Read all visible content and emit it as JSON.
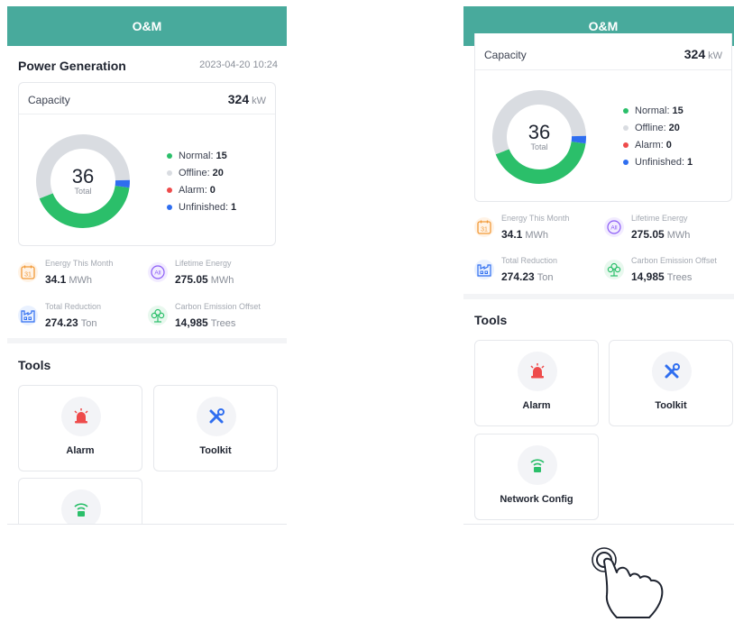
{
  "left": {
    "appbar_title": "O&M",
    "section_title": "Power Generation",
    "timestamp": "2023-04-20 10:24",
    "capacity_label": "Capacity",
    "capacity_value": "324",
    "capacity_unit": "kW",
    "donut_total": "36",
    "donut_total_label": "Total",
    "legend": [
      {
        "label": "Normal:",
        "value": "15"
      },
      {
        "label": "Offline:",
        "value": "20"
      },
      {
        "label": "Alarm:",
        "value": "0"
      },
      {
        "label": "Unfinished:",
        "value": "1"
      }
    ],
    "stats": [
      {
        "label": "Energy This Month",
        "value": "34.1",
        "unit": "MWh"
      },
      {
        "label": "Lifetime Energy",
        "value": "275.05",
        "unit": "MWh"
      },
      {
        "label": "Total Reduction",
        "value": "274.23",
        "unit": "Ton"
      },
      {
        "label": "Carbon Emission Offset",
        "value": "14,985",
        "unit": "Trees"
      }
    ],
    "tools_title": "Tools",
    "tools": [
      {
        "label": "Alarm"
      },
      {
        "label": "Toolkit"
      },
      {
        "label": ""
      }
    ]
  },
  "right": {
    "appbar_title": "O&M",
    "capacity_label": "Capacity",
    "capacity_value": "324",
    "capacity_unit": "kW",
    "donut_total": "36",
    "donut_total_label": "Total",
    "legend": [
      {
        "label": "Normal:",
        "value": "15"
      },
      {
        "label": "Offline:",
        "value": "20"
      },
      {
        "label": "Alarm:",
        "value": "0"
      },
      {
        "label": "Unfinished:",
        "value": "1"
      }
    ],
    "stats": [
      {
        "label": "Energy This Month",
        "value": "34.1",
        "unit": "MWh"
      },
      {
        "label": "Lifetime Energy",
        "value": "275.05",
        "unit": "MWh"
      },
      {
        "label": "Total Reduction",
        "value": "274.23",
        "unit": "Ton"
      },
      {
        "label": "Carbon Emission Offset",
        "value": "14,985",
        "unit": "Trees"
      }
    ],
    "tools_title": "Tools",
    "tools": [
      {
        "label": "Alarm"
      },
      {
        "label": "Toolkit"
      },
      {
        "label": "Network Config"
      }
    ]
  },
  "colors": {
    "appbar": "#48aa9c",
    "normal": "#2bbf6a",
    "offline": "#d9dce1",
    "alarm": "#ee4b4b",
    "unfinished": "#2f6ef0"
  },
  "icons": {
    "stats": [
      "calendar-icon",
      "lifetime-all-icon",
      "factory-icon",
      "tree-icon"
    ],
    "tools": [
      "alarm-siren-icon",
      "toolkit-icon",
      "network-config-icon"
    ],
    "tabs": [
      "list-tab-icon",
      "apps-tab-icon",
      "user-tab-icon"
    ],
    "gesture": "tap-hand-icon"
  }
}
